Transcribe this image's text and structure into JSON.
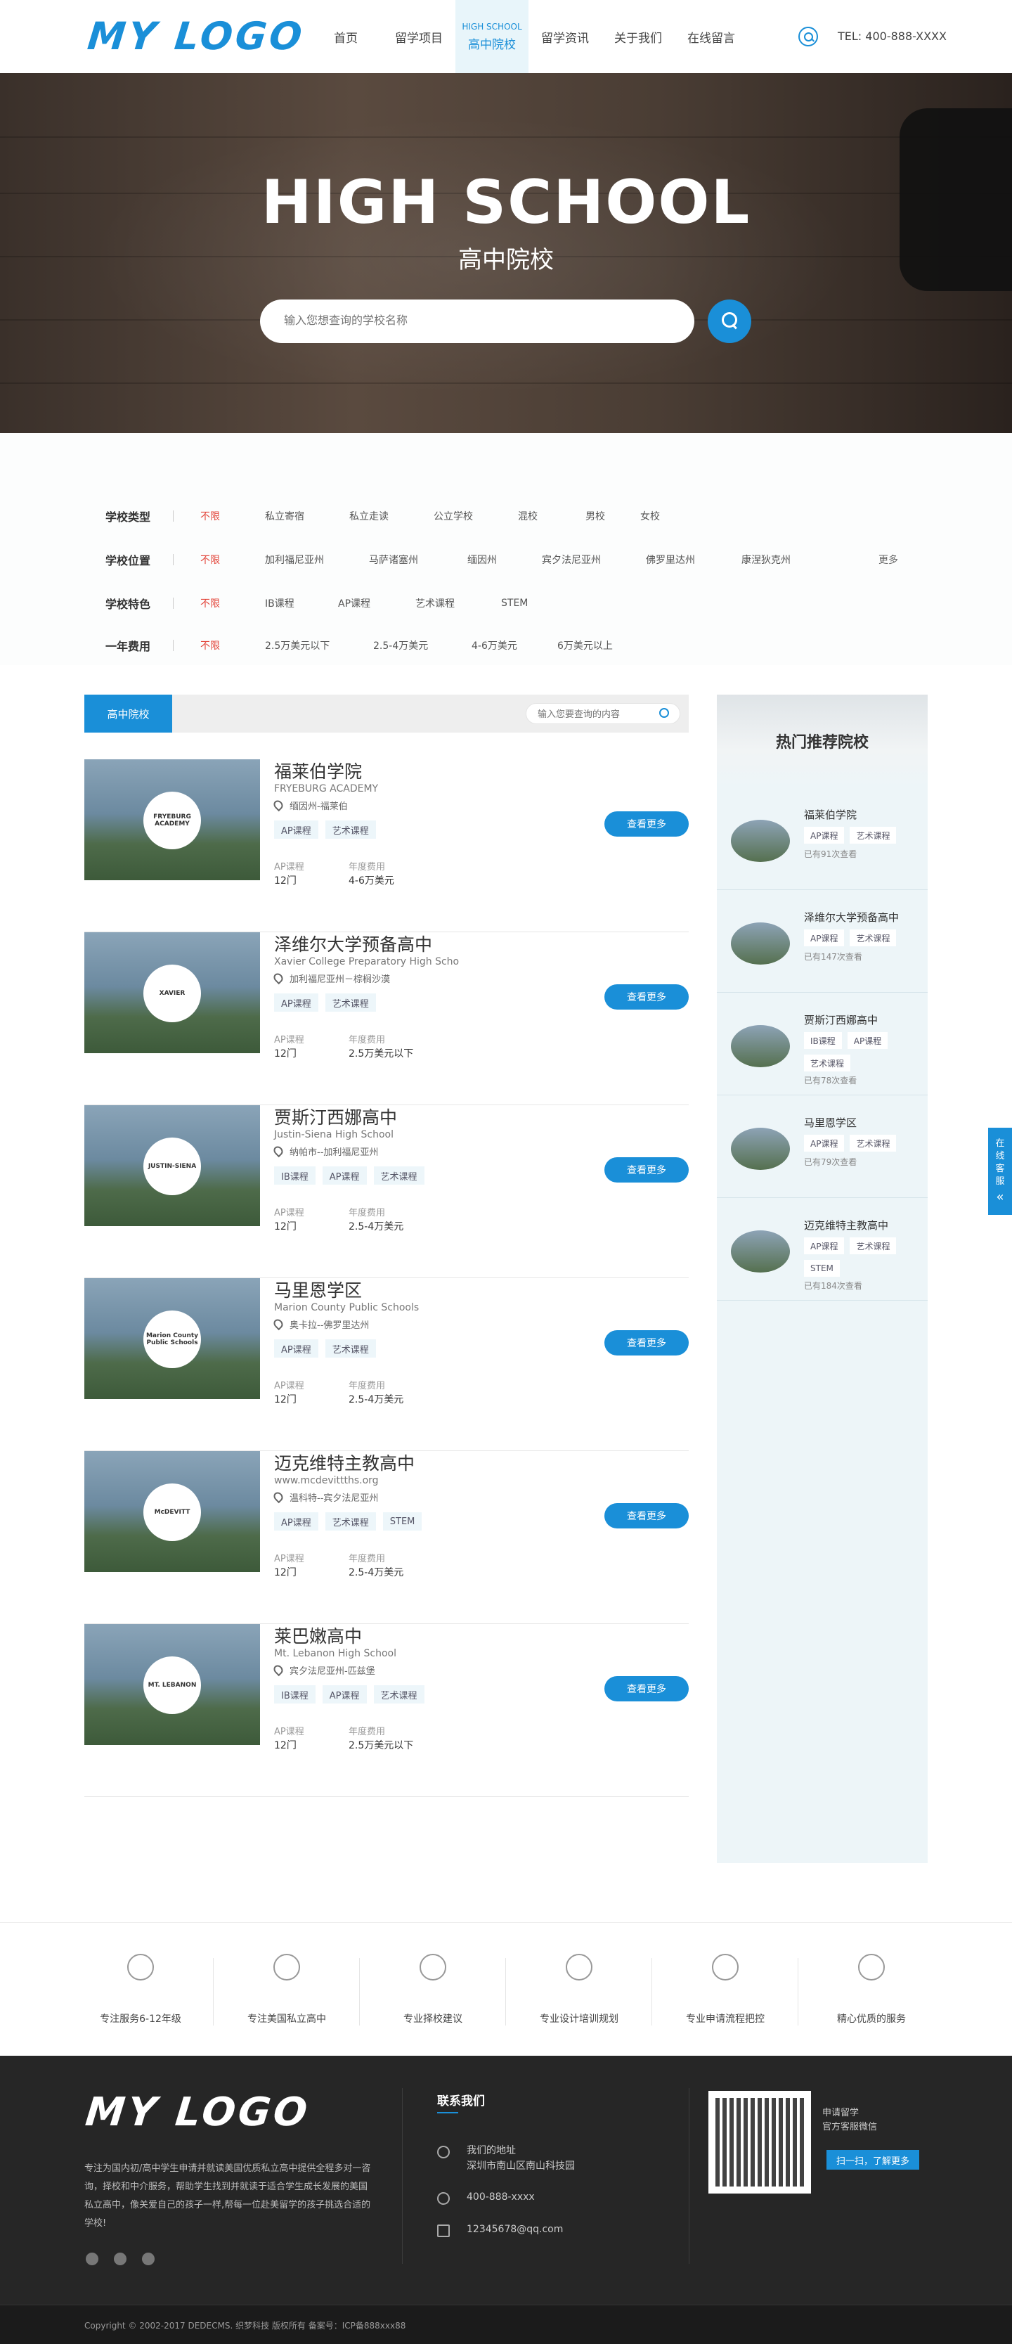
{
  "header": {
    "logo": "MY LOGO",
    "nav": [
      {
        "label": "首页"
      },
      {
        "label": "留学项目"
      },
      {
        "label": "高中院校",
        "en": "HIGH SCHOOL",
        "active": true
      },
      {
        "label": "留学资讯"
      },
      {
        "label": "关于我们"
      },
      {
        "label": "在线留言"
      }
    ],
    "tel": "TEL: 400-888-XXXX"
  },
  "banner": {
    "title": "HIGH SCHOOL",
    "subtitle": "高中院校",
    "search_placeholder": "输入您想查询的学校名称"
  },
  "filters": [
    {
      "label": "学校类型",
      "options": [
        "不限",
        "私立寄宿",
        "私立走读",
        "公立学校",
        "混校",
        "男校",
        "女校"
      ]
    },
    {
      "label": "学校位置",
      "options": [
        "不限",
        "加利福尼亚州",
        "马萨诸塞州",
        "缅因州",
        "宾夕法尼亚州",
        "佛罗里达州",
        "康涅狄克州"
      ],
      "more": "更多"
    },
    {
      "label": "学校特色",
      "options": [
        "不限",
        "IB课程",
        "AP课程",
        "艺术课程",
        "STEM"
      ]
    },
    {
      "label": "一年费用",
      "options": [
        "不限",
        "2.5万美元以下",
        "2.5-4万美元",
        "4-6万美元",
        "6万美元以上"
      ]
    }
  ],
  "list": {
    "tab_label": "高中院校",
    "search_placeholder": "输入您要查询的内容",
    "course_label": "AP课程",
    "fee_label": "年度费用",
    "more_label": "查看更多",
    "schools": [
      {
        "cn": "福莱伯学院",
        "en": "FRYEBURG ACADEMY",
        "loc": "缅因州-福莱伯",
        "tags": [
          "AP课程",
          "艺术课程"
        ],
        "courses": "12门",
        "fee": "4-6万美元",
        "seal": "FRYEBURG ACADEMY"
      },
      {
        "cn": "泽维尔大学预备高中",
        "en": "Xavier College Preparatory High Scho",
        "loc": "加利福尼亚州－棕榈沙漠",
        "tags": [
          "AP课程",
          "艺术课程"
        ],
        "courses": "12门",
        "fee": "2.5万美元以下",
        "seal": "XAVIER"
      },
      {
        "cn": "贾斯汀西娜高中",
        "en": "Justin-Siena High School",
        "loc": "纳帕市--加利福尼亚州",
        "tags": [
          "IB课程",
          "AP课程",
          "艺术课程"
        ],
        "courses": "12门",
        "fee": "2.5-4万美元",
        "seal": "JUSTIN-SIENA"
      },
      {
        "cn": "马里恩学区",
        "en": "Marion County Public Schools",
        "loc": "奥卡拉--佛罗里达州",
        "tags": [
          "AP课程",
          "艺术课程"
        ],
        "courses": "12门",
        "fee": "2.5-4万美元",
        "seal": "Marion County Public Schools"
      },
      {
        "cn": "迈克维特主教高中",
        "en": "www.mcdevittths.org",
        "loc": "温科特--宾夕法尼亚州",
        "tags": [
          "AP课程",
          "艺术课程",
          "STEM"
        ],
        "courses": "12门",
        "fee": "2.5-4万美元",
        "seal": "McDEVITT"
      },
      {
        "cn": "莱巴嫩高中",
        "en": "Mt. Lebanon High School",
        "loc": "宾夕法尼亚州-匹兹堡",
        "tags": [
          "IB课程",
          "AP课程",
          "艺术课程"
        ],
        "courses": "12门",
        "fee": "2.5万美元以下",
        "seal": "MT. LEBANON"
      }
    ]
  },
  "hot": {
    "title": "热门推荐院校",
    "items": [
      {
        "name": "福莱伯学院",
        "tags": [
          "AP课程",
          "艺术课程"
        ],
        "views": "已有91次查看"
      },
      {
        "name": "泽维尔大学预备高中",
        "tags": [
          "AP课程",
          "艺术课程"
        ],
        "views": "已有147次查看"
      },
      {
        "name": "贾斯汀西娜高中",
        "tags": [
          "IB课程",
          "AP课程",
          "艺术课程"
        ],
        "views": "已有78次查看"
      },
      {
        "name": "马里恩学区",
        "tags": [
          "AP课程",
          "艺术课程"
        ],
        "views": "已有79次查看"
      },
      {
        "name": "迈克维特主教高中",
        "tags": [
          "AP课程",
          "艺术课程",
          "STEM"
        ],
        "views": "已有184次查看"
      }
    ]
  },
  "float": {
    "label": "在线客服",
    "arrow": "«"
  },
  "features": [
    "专注服务6-12年级",
    "专注美国私立高中",
    "专业择校建议",
    "专业设计培训规划",
    "专业申请流程把控",
    "精心优质的服务"
  ],
  "footer": {
    "logo": "MY LOGO",
    "desc": "专注为国内初/高中学生申请并就读美国优质私立高中提供全程多对一咨询，择校和中介服务，帮助学生找到并就读于适合学生成长发展的美国私立高中，像关爱自己的孩子一样,帮每一位赴美留学的孩子挑选合适的学校!",
    "contact_title": "联系我们",
    "address_label": "我们的地址",
    "address": "深圳市南山区南山科技园",
    "phone": "400-888-xxxx",
    "email": "12345678@qq.com",
    "qr_note_1": "申请留学",
    "qr_note_2": "官方客服微信",
    "qr_btn": "扫一扫，了解更多",
    "copyright": "Copyright © 2002-2017 DEDECMS. 织梦科技 版权所有 备案号：ICP备888xxx88"
  }
}
